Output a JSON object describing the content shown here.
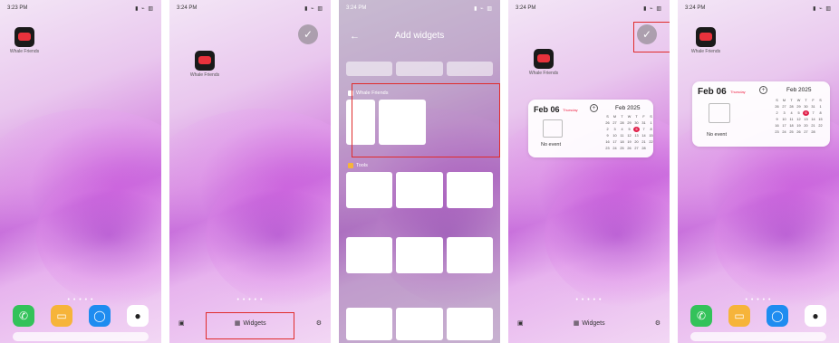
{
  "screens": [
    {
      "time": "3:23 PM"
    },
    {
      "time": "3:24 PM"
    },
    {
      "time": "3:24 PM"
    },
    {
      "time": "3:24 PM"
    },
    {
      "time": "3:24 PM"
    }
  ],
  "status_icons": "▮ ⌁ ▥",
  "app": {
    "name": "Whale\nFriends",
    "short": "Whale Friends"
  },
  "widgets_button": "Widgets",
  "add_widgets": {
    "title": "Add widgets",
    "back": "←",
    "section1": "Whale Friends",
    "section2": "Tools"
  },
  "calendar": {
    "date": "Feb 06",
    "day": "Thursday",
    "month": "Feb 2025",
    "no_event": "No event",
    "weekdays": [
      "S",
      "M",
      "T",
      "W",
      "T",
      "F",
      "S"
    ],
    "days": [
      "26",
      "27",
      "28",
      "29",
      "30",
      "31",
      "1",
      "2",
      "3",
      "4",
      "5",
      "6",
      "7",
      "8",
      "9",
      "10",
      "11",
      "12",
      "13",
      "14",
      "15",
      "16",
      "17",
      "18",
      "19",
      "20",
      "21",
      "22",
      "23",
      "24",
      "25",
      "26",
      "27",
      "28",
      ""
    ],
    "highlight_index": 11
  },
  "colors": {
    "highlight": "#e02b2b",
    "accent": "#e0204a"
  }
}
